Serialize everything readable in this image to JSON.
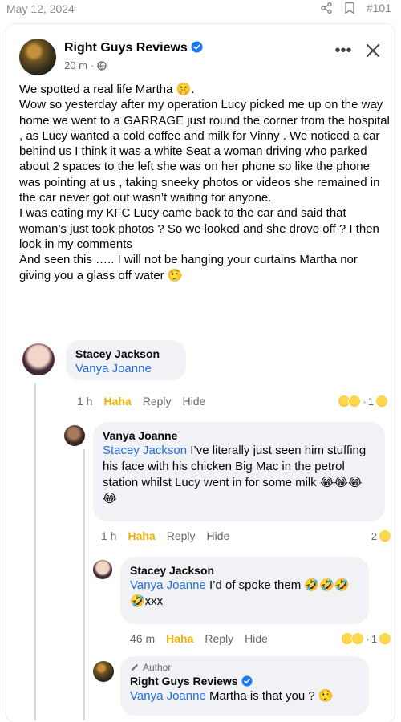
{
  "topbar": {
    "date": "May 12, 2024",
    "tag": "#101"
  },
  "post": {
    "author": "Right Guys Reviews",
    "time": "20 m",
    "body": [
      "We spotted a real life Martha 🤫.",
      "Wow so yesterday after my operation Lucy picked me up on the way home we went to a GARRAGE just round the corner from the hospital , as Lucy wanted a cold coffee and milk for Vinny . We noticed a car behind us I think it was a white Seat  a woman  driving who parked about 2 spaces to the left she was on her phone so like the phone was pointing at us , taking sneeky photos or videos she remained in the car never got out wasn’t waiting for anyone.",
      "I was eating my KFC  Lucy came back to the car and said that woman’s just took photos ? So we looked and she drove off ? I then look in my comments",
      "And seen this ….. I will not be hanging your curtains Martha nor giving you a glass off water 🤥"
    ]
  },
  "comments": [
    {
      "name": "Stacey Jackson",
      "mention": "Vanya Joanne",
      "text": "",
      "time": "1 h",
      "haha": "Haha",
      "reply": "Reply",
      "hide": "Hide",
      "reactions": "1"
    },
    {
      "name": "Vanya Joanne",
      "mention": "Stacey Jackson",
      "text": " I’ve literally just seen him stuffing his face with his chicken Big Mac in the petrol station whilst Lucy went in for some milk 😂😂😂😂",
      "time": "1 h",
      "haha": "Haha",
      "reply": "Reply",
      "hide": "Hide",
      "reactions": "2"
    },
    {
      "name": "Stacey Jackson",
      "mention": "Vanya Joanne",
      "text": " I’d of spoke them 🤣🤣🤣🤣xxx",
      "time": "46 m",
      "haha": "Haha",
      "reply": "Reply",
      "hide": "Hide",
      "reactions": "1"
    },
    {
      "author_tag": "Author",
      "name": "Right Guys Reviews",
      "mention": "Vanya Joanne",
      "text": " Martha is that you ? 🤥"
    }
  ],
  "colors": {
    "mention": "#216fdb",
    "haha": "#f0b000",
    "verified": "#1877f2"
  },
  "icons": [
    "share-icon",
    "bookmark-icon",
    "verified-badge-icon",
    "globe-icon",
    "more-icon",
    "close-icon",
    "pencil-icon"
  ]
}
